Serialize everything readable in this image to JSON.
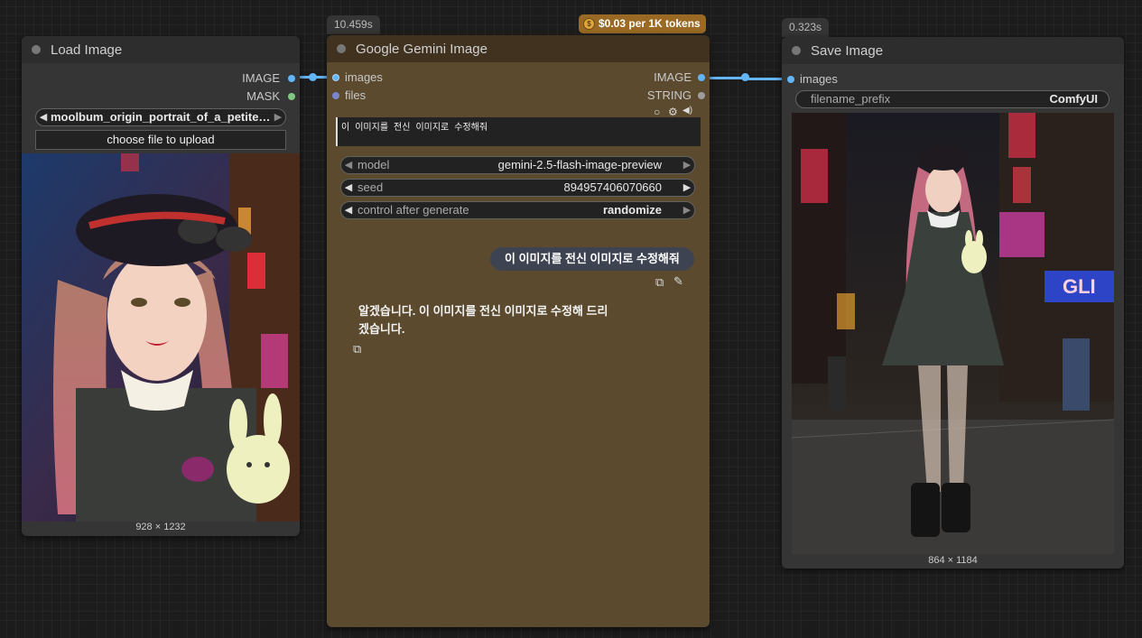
{
  "colors": {
    "link": "#64b5f6",
    "gemini_node": "#5b4a2e",
    "gemini_title": "#40321f",
    "price_badge": "#9a6a24"
  },
  "load_image": {
    "title": "Load Image",
    "outputs": [
      {
        "label": "IMAGE",
        "color": "#64b5f6"
      },
      {
        "label": "MASK",
        "color": "#81c784"
      }
    ],
    "image_widget": {
      "value": "moolbum_origin_portrait_of_a_petite ..."
    },
    "upload_button": "choose file to upload",
    "image_size": "928 × 1232"
  },
  "gemini": {
    "time_badge": "10.459s",
    "price": "$0.03 per 1K tokens",
    "title": "Google Gemini Image",
    "inputs": [
      {
        "label": "images",
        "color": "#64b5f6"
      },
      {
        "label": "files",
        "color": "#7986cb"
      }
    ],
    "outputs": [
      {
        "label": "IMAGE",
        "color": "#64b5f6"
      },
      {
        "label": "STRING",
        "color": "#9e9e9e"
      }
    ],
    "prompt": "이 이미지를 전신 이미지로 수정해줘",
    "widgets": [
      {
        "label": "model",
        "value": "gemini-2.5-flash-image-preview"
      },
      {
        "label": "seed",
        "value": "894957406070660"
      },
      {
        "label": "control after generate",
        "value": "randomize"
      }
    ],
    "chat": {
      "user_message": "이 이미지를 전신 이미지로 수정해줘",
      "reply_line1": "알겠습니다. 이 이미지를 전신 이미지로 수정해 드리",
      "reply_line2": "겠습니다."
    }
  },
  "save_image": {
    "time_badge": "0.323s",
    "title": "Save Image",
    "inputs": [
      {
        "label": "images",
        "color": "#64b5f6"
      }
    ],
    "filename_widget": {
      "label": "filename_prefix",
      "value": "ComfyUI"
    },
    "image_size": "864 × 1184"
  }
}
